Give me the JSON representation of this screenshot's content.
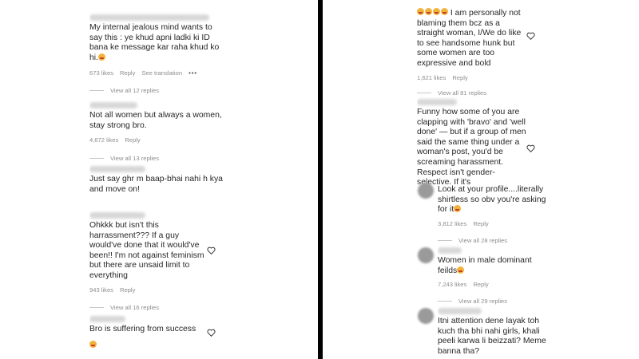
{
  "left_comments": [
    {
      "text": "My internal jealous mind wants to say this : ye khud apni ladki ki ID bana ke message kar raha khud ko hi.",
      "likes": "673 likes",
      "reply": "Reply",
      "translate": "See translation",
      "view_replies": "View all 12 replies"
    },
    {
      "text": "Not all women but always a women, stay strong bro.",
      "likes": "4,672 likes",
      "reply": "Reply",
      "view_replies": "View all 13 replies"
    },
    {
      "text": "Just say ghr m baap-bhai nahi h kya and move on!"
    },
    {
      "text": "Ohkkk but isn't this harrassment??? If a guy would've done that it would've been!! I'm not against feminism but there are unsaid limit to everything",
      "likes": "943 likes",
      "reply": "Reply",
      "view_replies": "View all 16 replies"
    },
    {
      "text": "Bro is suffering from success"
    }
  ],
  "right_comments": [
    {
      "text": "I am personally not blaming them bcz as a straight woman, I/We do like to see handsome hunk but some women are too expressive and bold",
      "likes": "1,621 likes",
      "reply": "Reply",
      "view_replies": "View all 81 replies"
    },
    {
      "text": "Funny how some of you are clapping with 'bravo' and 'well done' — but if a group of men said the same thing under a woman's post, you'd be screaming harassment. Respect isn't gender-selective. If it's"
    },
    {
      "text": "Look at your profile....literally shirtless so obv you're asking for it",
      "likes": "3,812 likes",
      "reply": "Reply",
      "view_replies": "View all 28 replies"
    },
    {
      "text": "Women in male dominant feilds",
      "likes": "7,243 likes",
      "reply": "Reply",
      "view_replies": "View all 29 replies"
    },
    {
      "text": "Itni attention dene layak toh kuch tha bhi nahi girls, khali peeli karwa li beizzati? Meme banna tha?"
    }
  ],
  "icons": {
    "heart": "heart-outline-icon",
    "more": "more-dots-icon",
    "emoji": "laughing-emoji-icon"
  },
  "colors": {
    "text": "#262626",
    "meta": "#8e8e8e",
    "divider": "#000000"
  }
}
